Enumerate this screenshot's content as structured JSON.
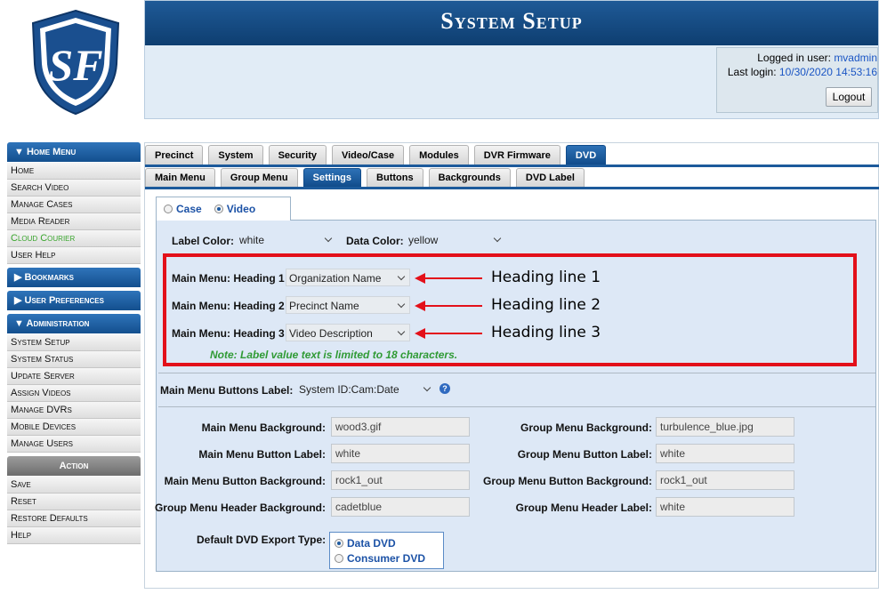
{
  "header": {
    "title": "System Setup",
    "logged_in_prefix": "Logged in user:",
    "logged_in_user": "mvadmin",
    "last_login_prefix": "Last login:",
    "last_login_value": "10/30/2020 14:53:16",
    "logout_label": "Logout"
  },
  "sidebar": {
    "home_menu": "Home Menu",
    "home_items": [
      "Home",
      "Search Video",
      "Manage Cases",
      "Media Reader",
      "Cloud Courier",
      "User Help"
    ],
    "bookmarks": "Bookmarks",
    "user_preferences": "User Preferences",
    "administration": "Administration",
    "admin_items": [
      "System Setup",
      "System Status",
      "Update Server",
      "Assign Videos",
      "Manage DVRs",
      "Mobile Devices",
      "Manage Users"
    ],
    "action": "Action",
    "action_items": [
      "Save",
      "Reset",
      "Restore Defaults",
      "Help"
    ]
  },
  "tabs": {
    "primary": [
      "Precinct",
      "System",
      "Security",
      "Video/Case",
      "Modules",
      "DVR Firmware",
      "DVD"
    ],
    "primary_active": "DVD",
    "secondary": [
      "Main Menu",
      "Group Menu",
      "Settings",
      "Buttons",
      "Backgrounds",
      "DVD Label"
    ],
    "secondary_active": "Settings"
  },
  "mode": {
    "case_label": "Case",
    "video_label": "Video",
    "selected": "Video"
  },
  "settings": {
    "label_color_label": "Label Color:",
    "label_color_value": "white",
    "data_color_label": "Data Color:",
    "data_color_value": "yellow",
    "heading1_label": "Main Menu: Heading 1",
    "heading1_value": "Organization Name",
    "heading2_label": "Main Menu: Heading 2",
    "heading2_value": "Precinct Name",
    "heading3_label": "Main Menu: Heading 3",
    "heading3_value": "Video Description",
    "note": "Note: Label value text is limited to 18 characters.",
    "buttons_label_label": "Main Menu Buttons Label:",
    "buttons_label_value": "System ID:Cam:Date"
  },
  "annotations": {
    "heading1": "Heading line 1",
    "heading2": "Heading line 2",
    "heading3": "Heading line 3"
  },
  "backgrounds": {
    "main_menu_background_label": "Main Menu Background:",
    "main_menu_background_value": "wood3.gif",
    "main_menu_button_label_label": "Main Menu Button Label:",
    "main_menu_button_label_value": "white",
    "main_menu_button_background_label": "Main Menu Button Background:",
    "main_menu_button_background_value": "rock1_out",
    "group_menu_header_background_label": "Group Menu Header Background:",
    "group_menu_header_background_value": "cadetblue",
    "group_menu_background_label": "Group Menu Background:",
    "group_menu_background_value": "turbulence_blue.jpg",
    "group_menu_button_label_label": "Group Menu Button Label:",
    "group_menu_button_label_value": "white",
    "group_menu_button_background_label": "Group Menu Button Background:",
    "group_menu_button_background_value": "rock1_out",
    "group_menu_header_label_label": "Group Menu Header Label:",
    "group_menu_header_label_value": "white"
  },
  "export": {
    "label": "Default DVD Export Type:",
    "options": [
      "Data DVD",
      "Consumer DVD"
    ],
    "selected": "Data DVD"
  },
  "colors": {
    "header_blue": "#134f8e",
    "highlight_red": "#e3101a",
    "note_green": "#2f9a34",
    "link_blue": "#1c52a6"
  }
}
